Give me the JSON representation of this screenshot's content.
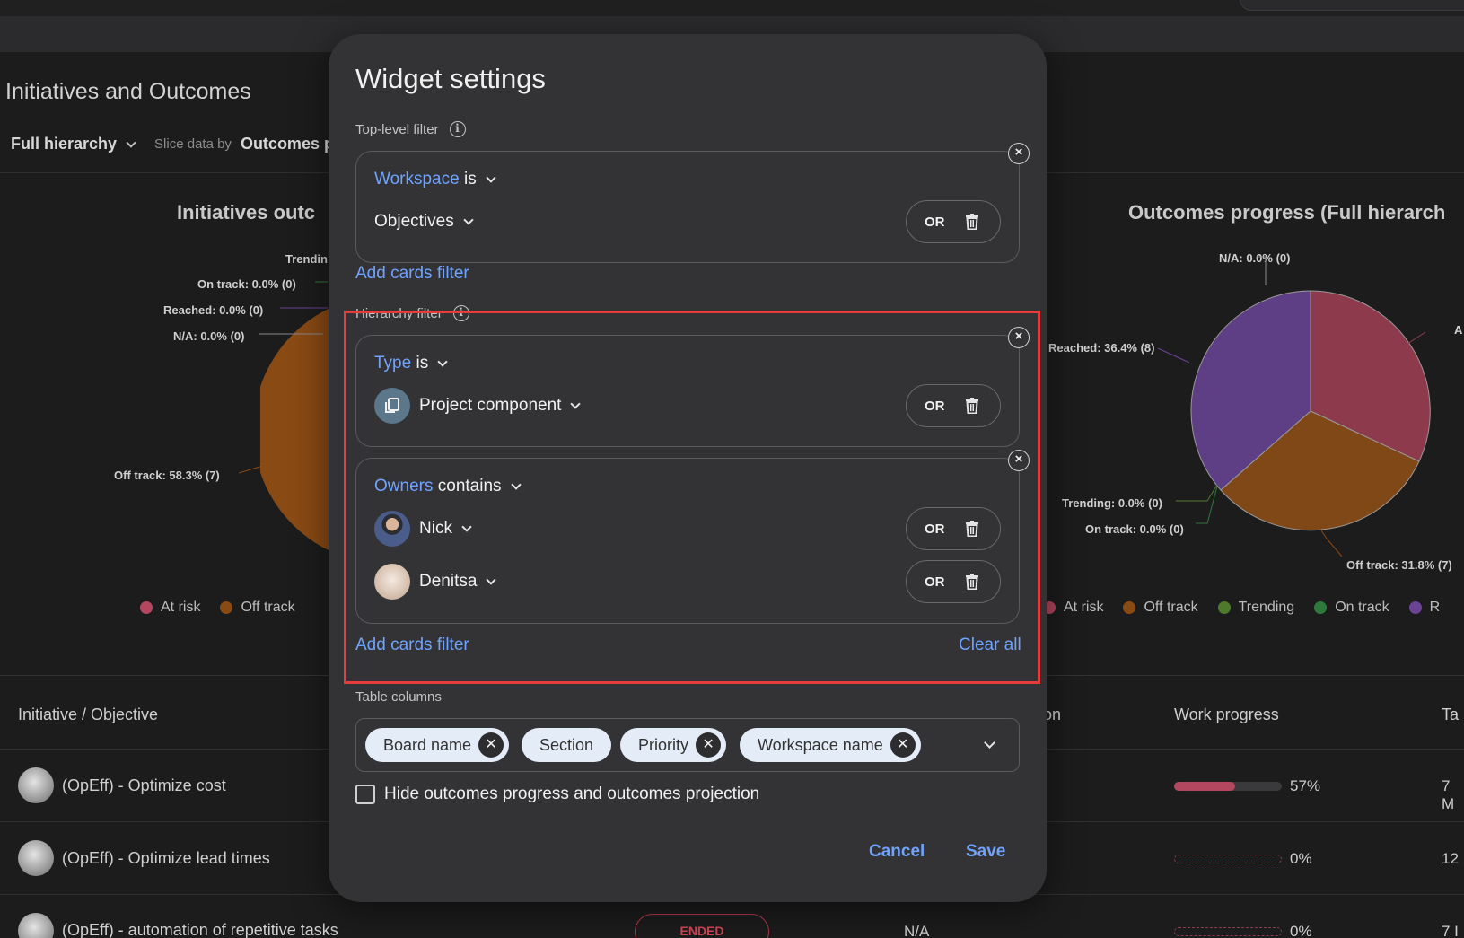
{
  "background": {
    "page_title": "Initiatives and Outcomes",
    "hierarchy_value": "Full hierarchy",
    "slice_label": "Slice data by",
    "slice_value": "Outcomes p",
    "left_chart": {
      "title": "Initiatives outc",
      "labels": [
        "Trendin",
        "On track: 0.0% (0)",
        "Reached: 0.0% (0)",
        "N/A: 0.0% (0)",
        "Off track: 58.3% (7)"
      ],
      "legend": [
        "At risk",
        "Off track"
      ]
    },
    "right_chart": {
      "title": "Outcomes progress (Full hierarch",
      "labels": [
        "N/A: 0.0% (0)",
        "Reached: 36.4% (8)",
        "Trending: 0.0% (0)",
        "On track: 0.0% (0)",
        "Off track: 31.8% (7)",
        "A"
      ],
      "legend": [
        "At risk",
        "Off track",
        "Trending",
        "On track",
        "R"
      ]
    },
    "table": {
      "headers": [
        "Initiative / Objective",
        "on",
        "Work progress",
        "Ta"
      ],
      "rows": [
        {
          "name": "(OpEff) - Optimize cost",
          "progress": "57%",
          "progress_value": 57,
          "target": "7 M"
        },
        {
          "name": "(OpEff) - Optimize lead times",
          "progress": "0%",
          "progress_value": 0,
          "target": "12"
        },
        {
          "name": "(OpEff) - automation of repetitive tasks",
          "status": "ENDED",
          "na": "N/A",
          "progress": "0%",
          "progress_value": 0,
          "target": "7 I"
        }
      ]
    },
    "colors": {
      "at_risk": "#b2475f",
      "off_track": "#8a4a14",
      "trending": "#4f7a2e",
      "on_track": "#2e7a3c",
      "reached": "#6a4394"
    }
  },
  "modal": {
    "title": "Widget settings",
    "top_level_label": "Top-level filter",
    "top_filter": {
      "field": "Workspace",
      "op": "is",
      "value": "Objectives"
    },
    "add_cards_filter": "Add cards filter",
    "hierarchy_label": "Hierarchy filter",
    "type_filter": {
      "field": "Type",
      "op": "is",
      "value": "Project component"
    },
    "owners_filter": {
      "field": "Owners",
      "op": "contains",
      "values": [
        "Nick",
        "Denitsa"
      ]
    },
    "or_label": "OR",
    "clear_all": "Clear all",
    "table_columns_label": "Table columns",
    "chips": [
      "Board name",
      "Section",
      "Priority",
      "Workspace name"
    ],
    "checkbox_label": "Hide outcomes progress and outcomes projection",
    "cancel": "Cancel",
    "save": "Save"
  }
}
